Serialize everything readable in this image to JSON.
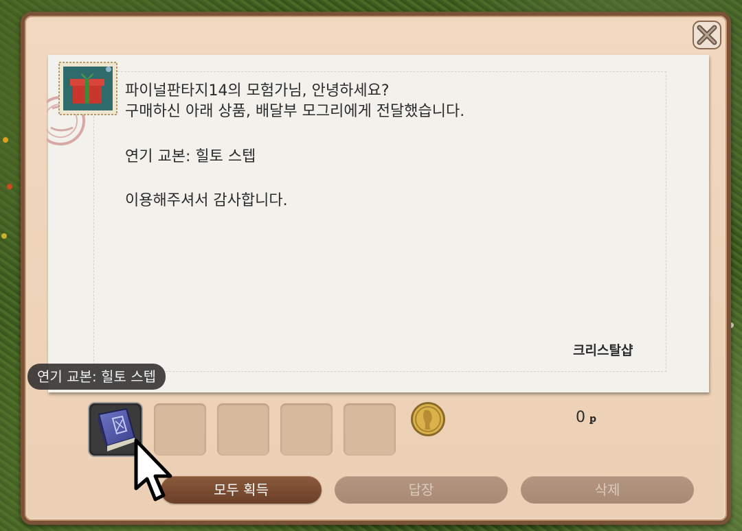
{
  "letter": {
    "line1": "파이널판타지14의 모험가님, 안녕하세요?",
    "line2": "구매하신 아래 상품, 배달부 모그리에게 전달했습니다.",
    "item_line": "연기 교본: 힐토 스텝",
    "thanks": "이용해주셔서 감사합니다.",
    "signature": "크리스탈샵"
  },
  "tooltip": {
    "text": "연기 교본: 힐토 스텝"
  },
  "attachments": {
    "gil_amount": "0",
    "gil_unit": "ꝑ",
    "slots": [
      {
        "icon": "book-icon",
        "filled": true
      },
      {
        "filled": false
      },
      {
        "filled": false
      },
      {
        "filled": false
      },
      {
        "filled": false
      }
    ]
  },
  "buttons": {
    "take_all": "모두 획득",
    "reply": "답장",
    "delete": "삭제"
  },
  "icons": {
    "close": "close-icon",
    "stamp": "gift-stamp-icon",
    "coin": "gil-coin-icon"
  },
  "colors": {
    "frame": "#7a5238",
    "panel": "#ecd0b5",
    "paper": "#f3f1ec",
    "primary_button": "#7a4c31",
    "disabled_button": "#ad8f7a"
  }
}
